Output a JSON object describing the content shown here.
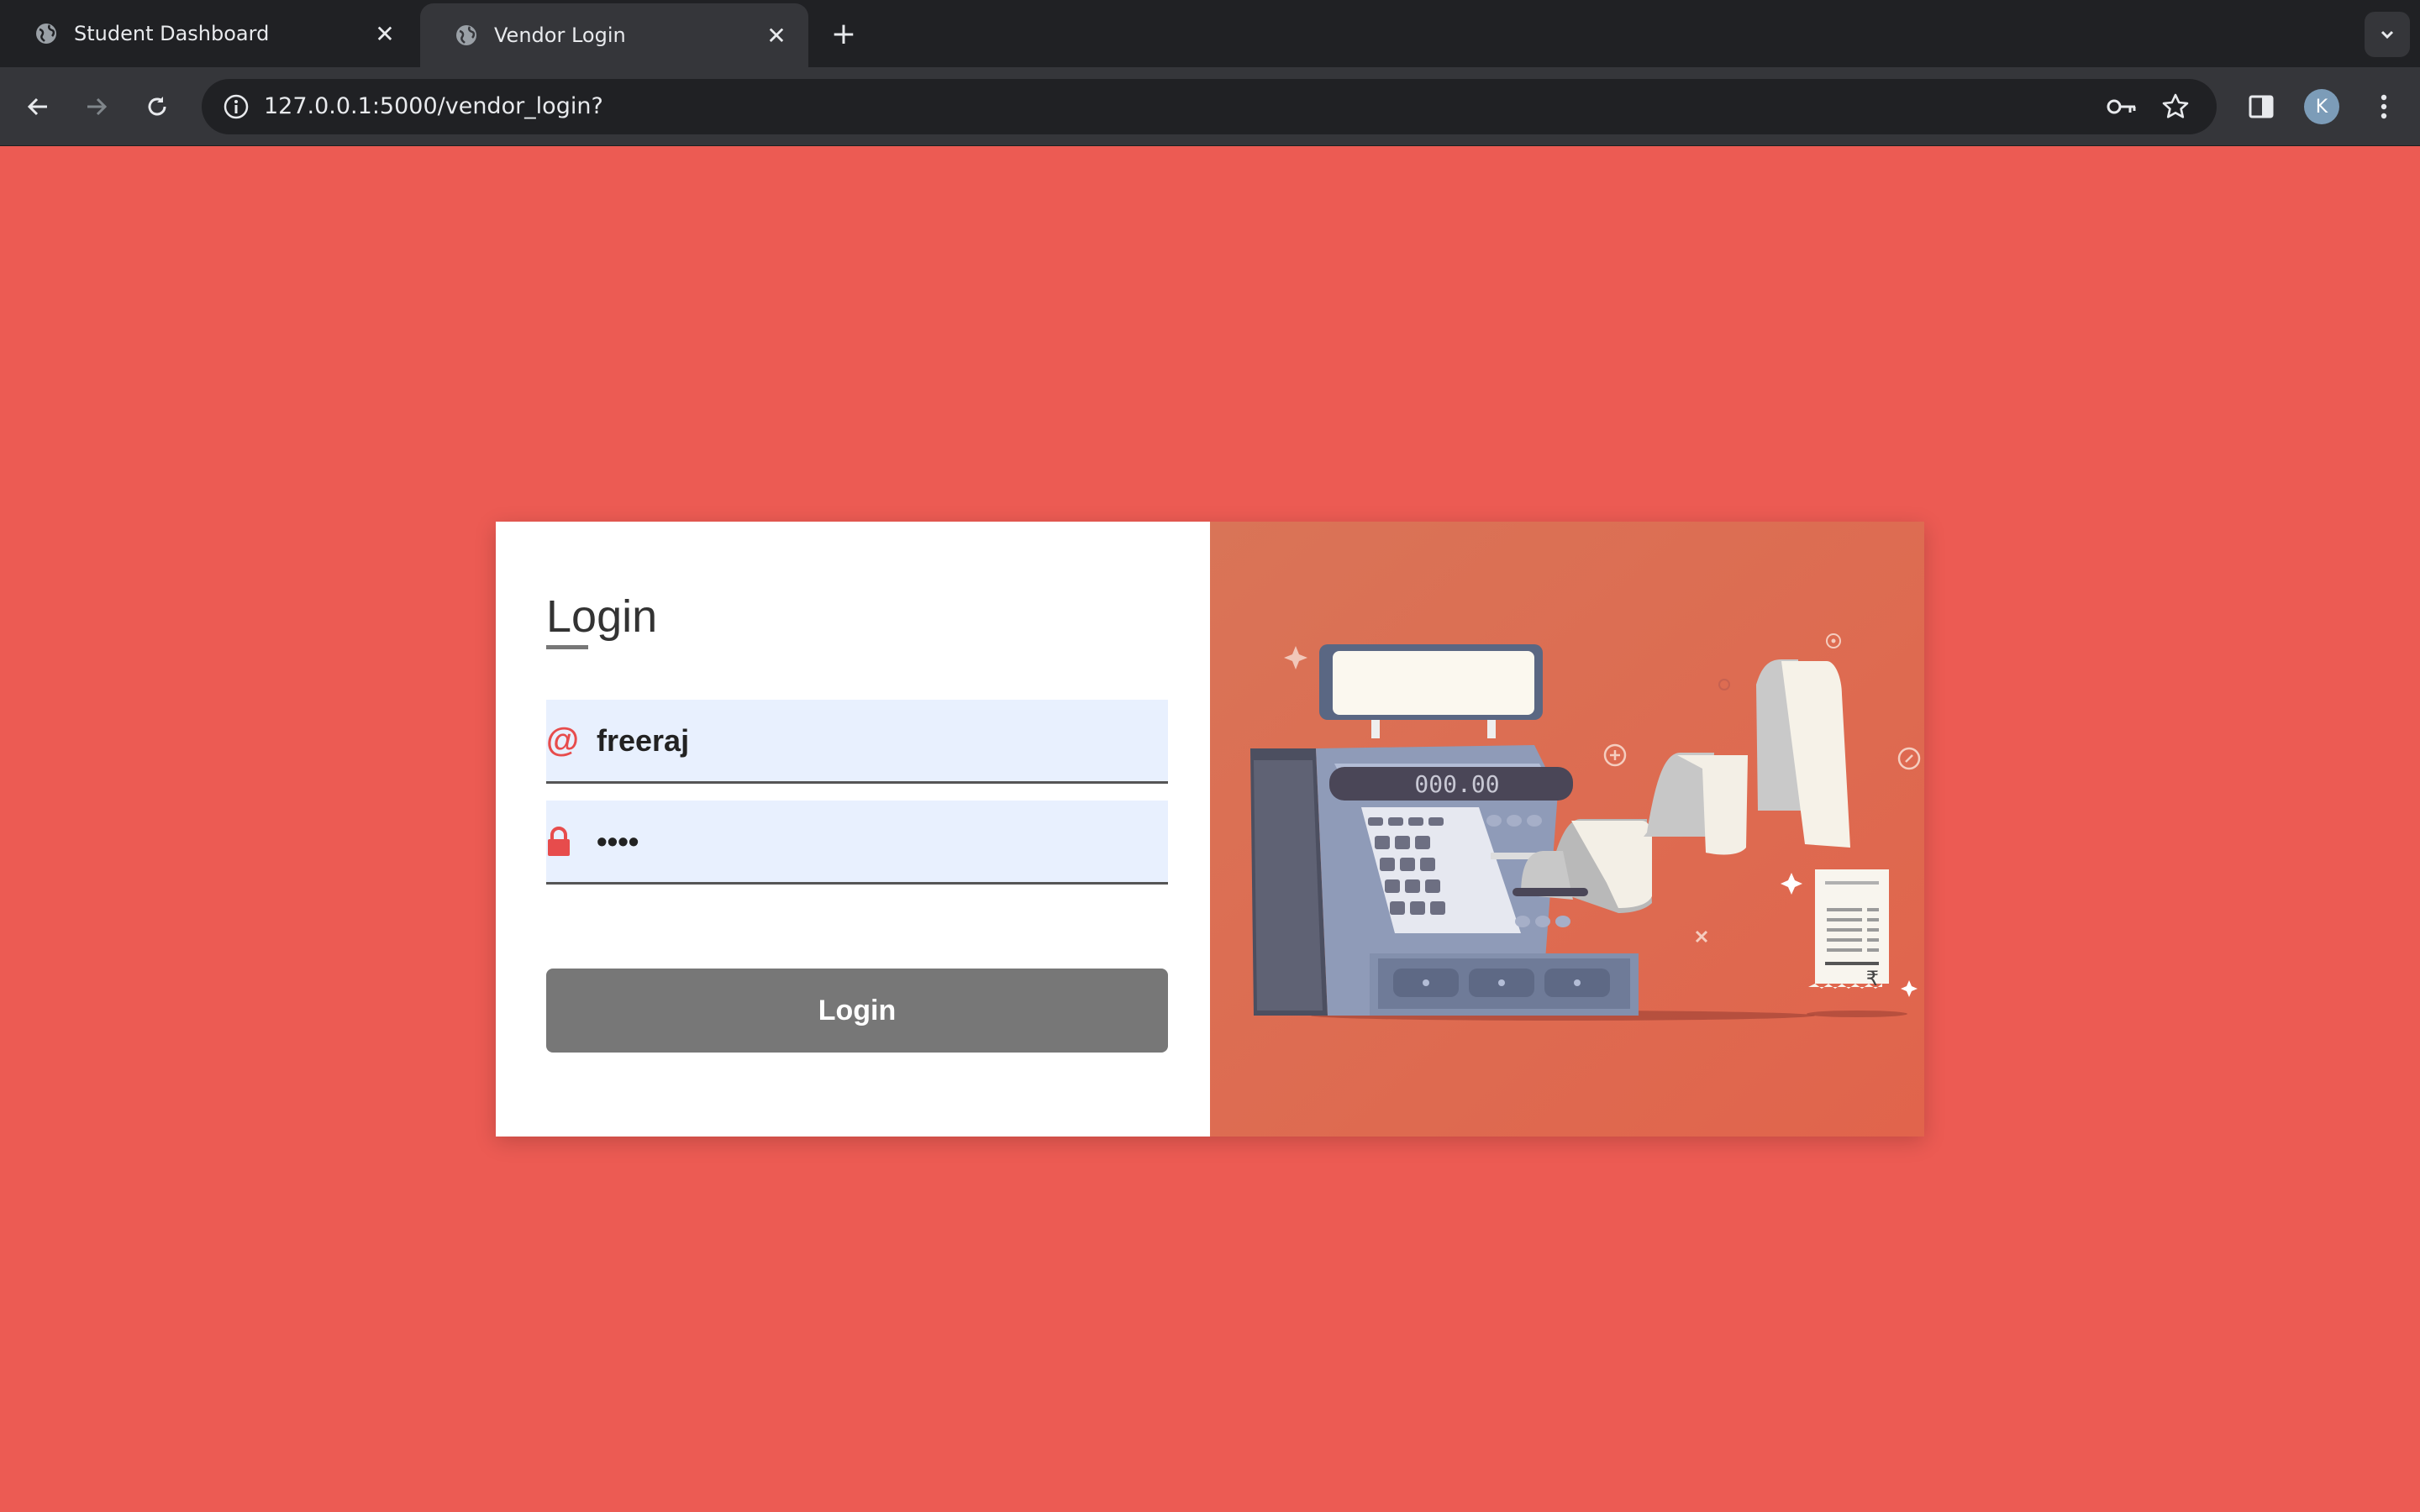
{
  "browser": {
    "tabs": [
      {
        "title": "Student Dashboard",
        "active": false
      },
      {
        "title": "Vendor Login",
        "active": true
      }
    ],
    "url": "127.0.0.1:5000/vendor_login?",
    "profile_initial": "K"
  },
  "login": {
    "title": "Login",
    "username_value": "freeraj",
    "password_masked": "••••",
    "submit_label": "Login"
  },
  "illustration": {
    "register_display": "000.00",
    "currency_symbol": "₹"
  },
  "colors": {
    "page_background": "#ec5b53",
    "illustration_background": "#e26a50",
    "field_background": "#e8f0fe",
    "button_background": "#777777",
    "icon_accent": "#e74c4c"
  }
}
